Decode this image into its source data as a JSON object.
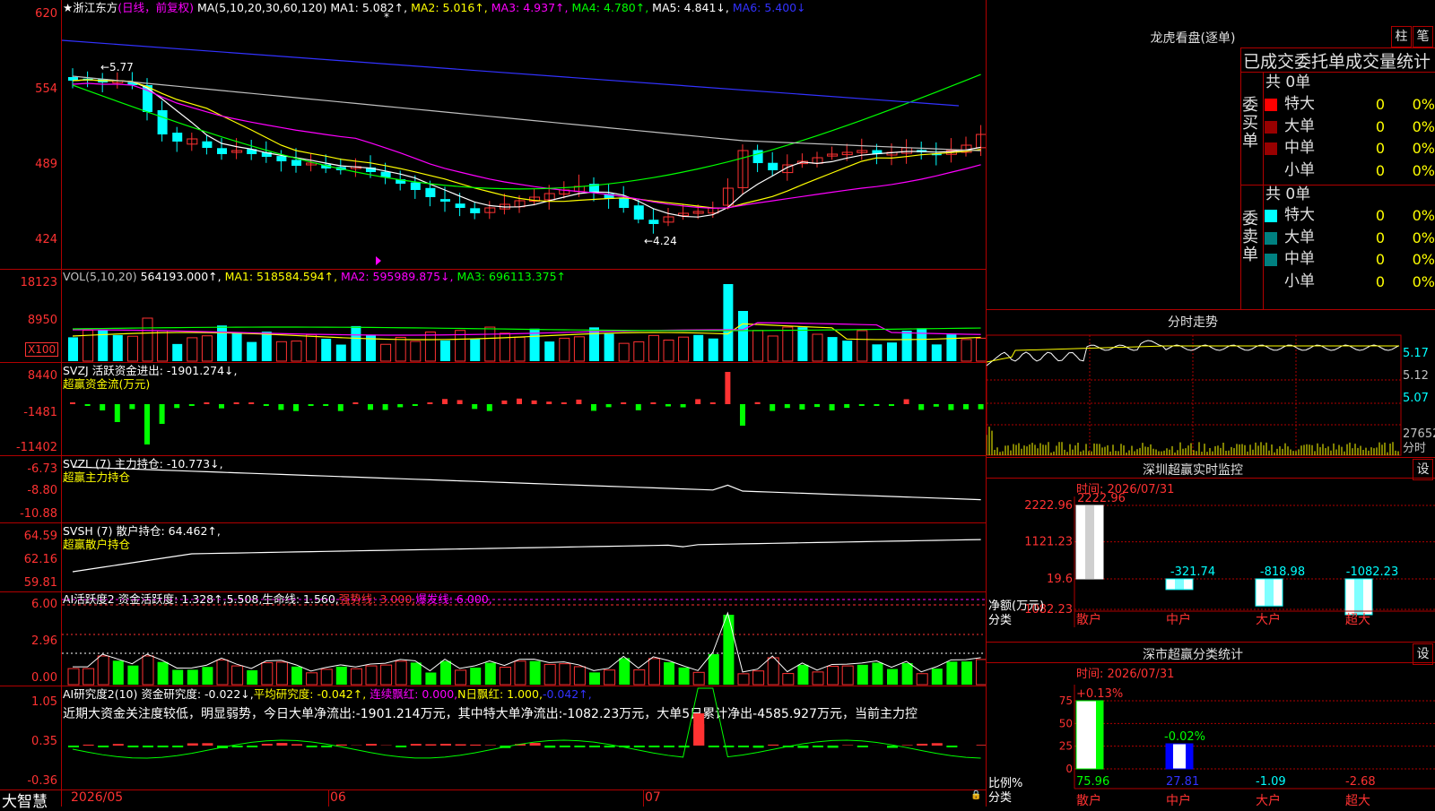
{
  "stock": {
    "name": "★浙江东方",
    "mode": "(日线，前复权)",
    "ma_prefix": "MA(5,10,20,30,60,120)",
    "ma1": "MA1: 5.082↑,",
    "ma2": "MA2: 5.016↑,",
    "ma3": "MA3: 4.937↑,",
    "ma4": "MA4: 4.780↑,",
    "ma5": "MA5: 4.841↓,",
    "ma6": "MA6: 5.400↓",
    "high_note": "←5.77",
    "low_note": "←4.24",
    "star": "*"
  },
  "price_axis": [
    "620",
    "554",
    "489",
    "424"
  ],
  "vol": {
    "header": "VOL(5,10,20)",
    "value": "564193.000↑,",
    "ma1": "MA1: 518584.594↑,",
    "ma2": "MA2: 595989.875↓,",
    "ma3": "MA3: 696113.375↑",
    "axis": [
      "18123",
      "8950"
    ],
    "unit": "X100"
  },
  "svzj": {
    "header": "SVZJ  活跃资金进出: -1901.274↓,",
    "sub": "超赢资金流(万元)",
    "axis": [
      "8440",
      "-1481",
      "-11402"
    ]
  },
  "svzl": {
    "header": "SVZL (7) 主力持仓: -10.773↓,",
    "sub": "超赢主力持仓",
    "axis": [
      "-6.73",
      "-8.80",
      "-10.88"
    ]
  },
  "svsh": {
    "header": "SVSH (7) 散户持仓: 64.462↑,",
    "sub": "超赢散户持仓",
    "axis": [
      "64.59",
      "62.16",
      "59.81"
    ]
  },
  "ai1": {
    "header_a": "AI活跃度2 资金活跃度: 1.328↑,5.508,生命线: 1.560,",
    "header_b": "强势线: 3.000,",
    "header_c": "爆发线: 6.000,",
    "axis": [
      "6.00",
      "2.96",
      "0.00"
    ]
  },
  "ai2": {
    "header_a": "AI研究度2(10) 资金研究度: -0.022↓,",
    "header_b": "平均研究度: -0.042↑,",
    "header_c": "连续飘红: 0.000,",
    "header_d": "N日飘红: 1.000,",
    "header_e": "-0.042↑,",
    "comment": "近期大资金关注度较低，明显弱势，今日大单净流出:-1901.214万元，其中特大单净流出:-1082.23万元，大单5日累计净出-4585.927万元，当前主力控",
    "axis": [
      "1.05",
      "0.35",
      "-0.36"
    ]
  },
  "bottom": {
    "brand": "大智慧",
    "date1": "2026/05",
    "date2": "06",
    "date3": "07"
  },
  "longhu": {
    "title": "龙虎看盘(逐单)",
    "btn1": "柱",
    "btn2": "笔",
    "tab_title": "已成交委托单成交量统计",
    "buy_label": "委买单",
    "sell_label": "委卖单",
    "buy_total": "共 0单",
    "sell_total": "共 0单",
    "rows": [
      "特大",
      "大单",
      "中单",
      "小单"
    ],
    "zero": "0",
    "pct": "0%"
  },
  "fenshi": {
    "title": "分时走势",
    "axis": [
      "5.17",
      "5.12",
      "5.07"
    ],
    "vol_axis": "27652",
    "vol_label": "分时"
  },
  "sz_monitor": {
    "title": "深圳超赢实时监控",
    "btn": "设",
    "time": "时间: 2026/07/31",
    "axis": [
      "2222.96",
      "1121.23",
      "19.6",
      "-1082.23"
    ],
    "values": [
      2222.96,
      -321.74,
      -818.98,
      -1082.23
    ],
    "value_labels": [
      "2222.96",
      "-321.74",
      "-818.98",
      "-1082.23"
    ],
    "ylabel1": "净额(万元)",
    "ylabel2": "分类",
    "cats": [
      "散户",
      "中户",
      "大户",
      "超大"
    ]
  },
  "sz_class": {
    "title": "深市超赢分类统计",
    "btn": "设",
    "time": "时间: 2026/07/31",
    "axis": [
      "75",
      "50",
      "25",
      "0"
    ],
    "top_labels": [
      "+0.13%",
      "-0.02%"
    ],
    "bottom_labels": [
      "75.96",
      "27.81",
      "-1.09",
      "-2.68"
    ],
    "ylabel1": "比例%",
    "ylabel2": "分类",
    "cats": [
      "散户",
      "中户",
      "大户",
      "超大"
    ]
  },
  "colors": {
    "up": "#ff3232",
    "down": "#00ffff",
    "grid": "#b00000"
  }
}
